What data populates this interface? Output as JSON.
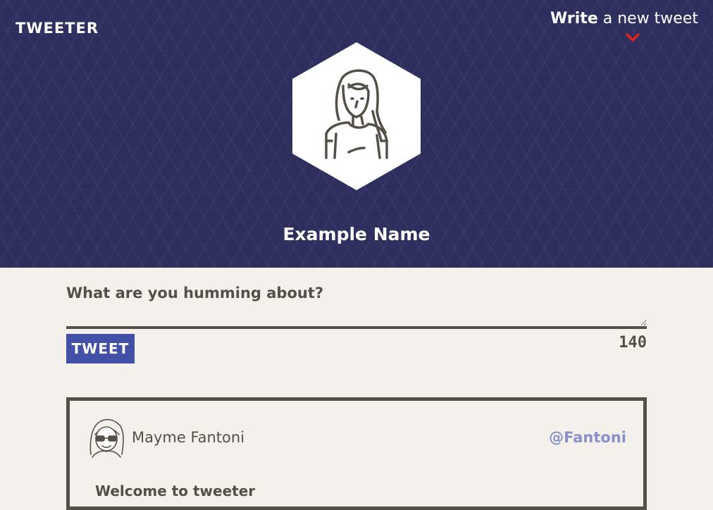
{
  "nav": {
    "logo": "TWEETER",
    "compose_toggle_strong": "Write",
    "compose_toggle_rest": " a new tweet",
    "chevron_icon": "chevron-down-icon",
    "chevron_color": "#e2231a"
  },
  "profile": {
    "avatar_icon": "woman-avatar-icon",
    "name": "Example Name"
  },
  "composer": {
    "placeholder": "What are you humming about?",
    "value": "",
    "button_label": "TWEET",
    "counter": "140"
  },
  "tweets": [
    {
      "avatar_icon": "glasses-avatar-icon",
      "author": "Mayme Fantoni",
      "handle": "@Fantoni",
      "text": "Welcome to tweeter"
    }
  ],
  "colors": {
    "header_bg": "#2e2f5e",
    "page_bg": "#f4f1ec",
    "accent": "#4350a8",
    "text": "#545048",
    "handle": "#8a91c8"
  }
}
